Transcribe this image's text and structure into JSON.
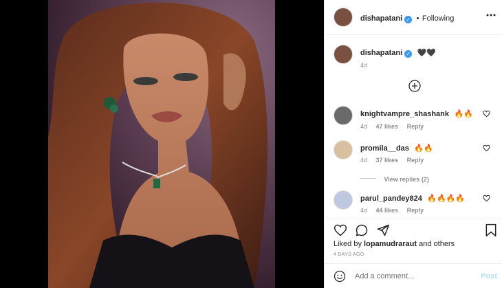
{
  "header": {
    "username": "dishapatani",
    "separator": "•",
    "follow_status": "Following",
    "more_icon": "more-horizontal-icon"
  },
  "caption": {
    "username": "dishapatani",
    "text": "🖤🖤",
    "time": "4d"
  },
  "load_more_icon": "plus-circle-icon",
  "comments": [
    {
      "username": "knightvampre_shashank",
      "text": "🔥🔥",
      "time": "4d",
      "likes": "47 likes",
      "reply": "Reply"
    },
    {
      "username": "promila__das",
      "text": "🔥🔥",
      "time": "4d",
      "likes": "37 likes",
      "reply": "Reply",
      "view_replies": "View replies (2)"
    },
    {
      "username": "parul_pandey824",
      "text": "🔥🔥🔥🔥",
      "time": "4d",
      "likes": "44 likes",
      "reply": "Reply"
    }
  ],
  "actions": {
    "like_icon": "heart-icon",
    "comment_icon": "comment-icon",
    "share_icon": "send-icon",
    "save_icon": "bookmark-icon"
  },
  "likes_summary": {
    "prefix": "Liked by",
    "user": "lopamudraraut",
    "suffix": "and others"
  },
  "post_time": "4 DAYS AGO",
  "add_comment": {
    "emoji_icon": "smiley-icon",
    "placeholder": "Add a comment...",
    "post_label": "Post"
  },
  "colors": {
    "verified": "#3897f0",
    "post_button": "#b2dffc",
    "muted": "#8e8e8e",
    "text": "#262626"
  }
}
